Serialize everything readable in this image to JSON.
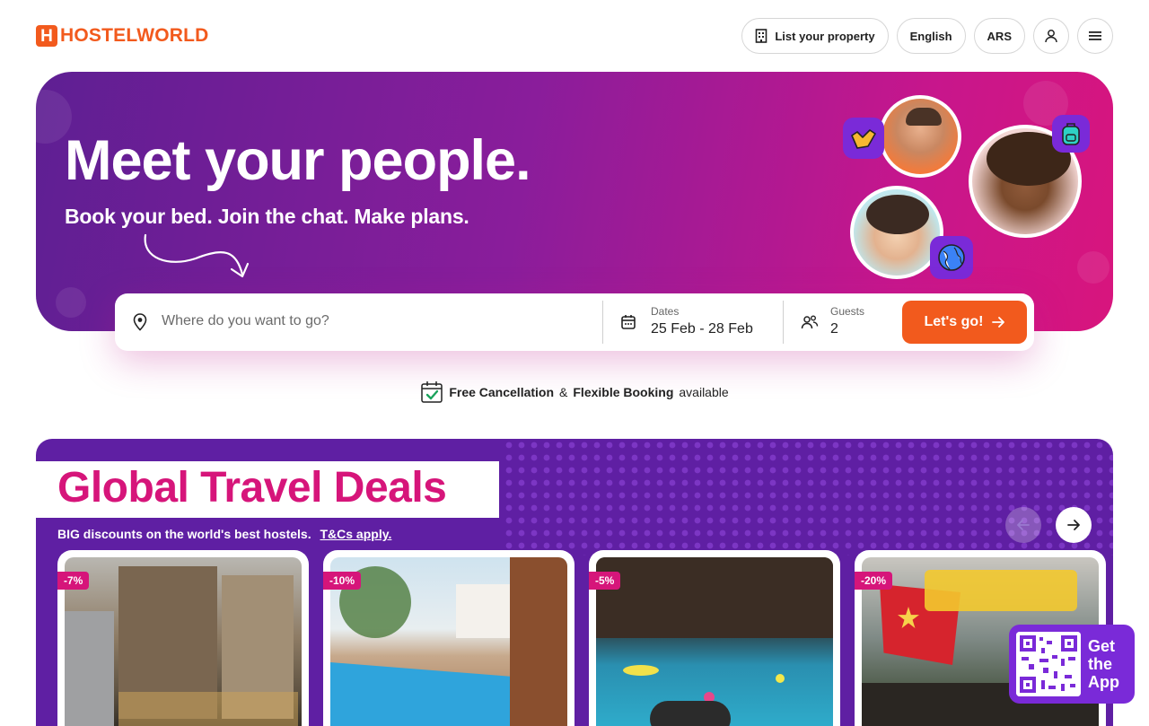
{
  "header": {
    "logo_mark": "H",
    "logo_text": "HOSTELWORLD",
    "list_property_label": "List your property",
    "language_label": "English",
    "currency_label": "ARS"
  },
  "hero": {
    "title": "Meet your people.",
    "subtitle": "Book your bed. Join the chat. Make plans."
  },
  "search": {
    "destination_placeholder": "Where do you want to go?",
    "dates_label": "Dates",
    "dates_value": "25 Feb - 28 Feb",
    "guests_label": "Guests",
    "guests_value": "2",
    "submit_label": "Let's go!"
  },
  "cancellation": {
    "part1": "Free Cancellation",
    "connector": "&",
    "part2": "Flexible Booking",
    "suffix": "available"
  },
  "deals": {
    "title": "Global Travel Deals",
    "subtitle": "BIG discounts on the world's best hostels.",
    "terms_link": "T&Cs apply.",
    "cards": [
      {
        "discount": "-7%"
      },
      {
        "discount": "-10%"
      },
      {
        "discount": "-5%"
      },
      {
        "discount": "-20%"
      }
    ]
  },
  "app_promo": {
    "line1": "Get",
    "line2": "the",
    "line3": "App"
  },
  "colors": {
    "brand_orange": "#f25a1d",
    "deal_pink": "#d6157a",
    "deals_purple": "#5f1fa3"
  }
}
